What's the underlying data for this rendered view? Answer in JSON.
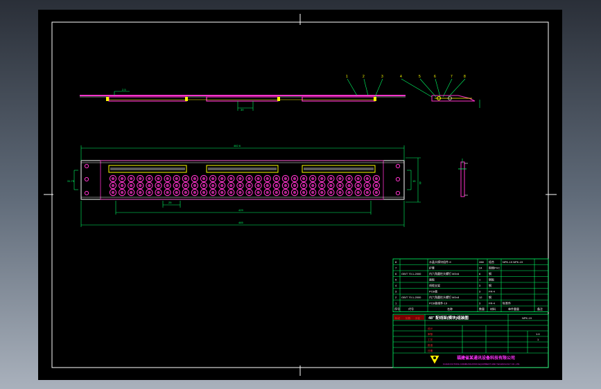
{
  "drawing": {
    "dim_total_length": "482.6",
    "dim_overall_width": "465",
    "dim_inner_pitch": "429",
    "dim_mount_height": "44",
    "dim_mount_pitch": "31.75",
    "dim_port_spacing": "25",
    "dim_small": "15",
    "dim_top_offset": "39",
    "dim_gap": "2.5",
    "balloons": [
      "1",
      "2",
      "3",
      "4",
      "5",
      "6",
      "7",
      "8"
    ]
  },
  "bom": {
    "rows": [
      {
        "seq": "8",
        "code": "",
        "name": "水晶头模块组件-9",
        "qty": "288",
        "material": "组合",
        "note": "NPK-19 NPK-19"
      },
      {
        "seq": "7",
        "code": "",
        "name": "护套",
        "qty": "24",
        "material": "阻燃PVC",
        "note": ""
      },
      {
        "seq": "6",
        "code": "GB/T 70.1-2000",
        "name": "内六角圆柱头螺钉 M3×6",
        "qty": "6",
        "material": "钢",
        "note": ""
      },
      {
        "seq": "5",
        "code": "",
        "name": "面板",
        "qty": "1",
        "material": "钢板",
        "note": ""
      },
      {
        "seq": "4",
        "code": "",
        "name": "线缆支架",
        "qty": "3",
        "material": "钢",
        "note": ""
      },
      {
        "seq": "3",
        "code": "",
        "name": "PCB板",
        "qty": "3",
        "material": "FR-4",
        "note": ""
      },
      {
        "seq": "2",
        "code": "GB/T 70.1-2000",
        "name": "内六角圆柱头螺钉 M3×8",
        "qty": "12",
        "material": "钢",
        "note": ""
      },
      {
        "seq": "1",
        "code": "",
        "name": "PCB板组件-19",
        "qty": "3",
        "material": "FR-4",
        "note": "标准件"
      }
    ],
    "header": {
      "seq": "序号",
      "code": "代号",
      "name": "名称",
      "qty": "数量",
      "material": "材料",
      "weight": "单件重量",
      "note": "备注"
    }
  },
  "title_block": {
    "drawing_title": "48\" 配线架(模块)组装图",
    "drawing_no": "NPK-19",
    "scale": "1:4",
    "sheet": "1",
    "labels": [
      "标记",
      "处数",
      "分区",
      "设计",
      "审核",
      "工艺",
      "批准",
      "日期"
    ],
    "company_cn": "福建省某通讯设备科技有限公司",
    "company_en": "FUJIAN FUTONG COMMUNICATION EQUIPMENT AND TECHNOLOGY CO.,LTD."
  },
  "colors": {
    "background": "#000000",
    "frame": "#ffffff",
    "part": "#ff33cc",
    "dimension": "#00ff66",
    "accent": "#ffff00",
    "table": "#00ff66",
    "company": "#ff33ff"
  }
}
